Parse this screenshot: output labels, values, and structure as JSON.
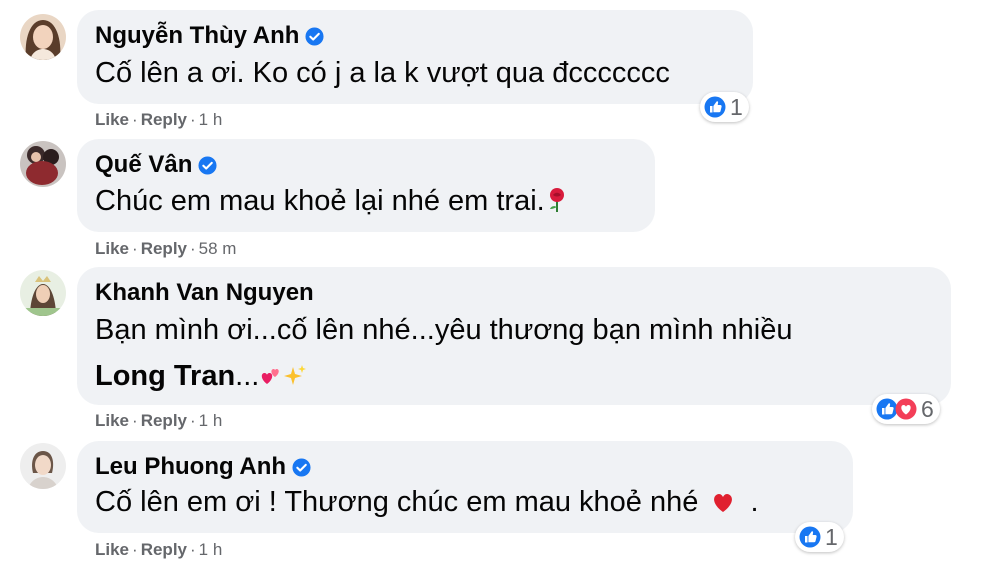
{
  "comments": [
    {
      "author": "Nguyễn Thùy Anh",
      "verified": true,
      "text_plain": "Cố lên a ơi. Ko có j a la k vượt qua đccccccc",
      "actions": {
        "like": "Like",
        "reply": "Reply",
        "time": "1 h"
      },
      "reaction_count": "1"
    },
    {
      "author": "Quế Vân",
      "verified": true,
      "text_plain": "Chúc em mau khoẻ lại nhé em trai.",
      "actions": {
        "like": "Like",
        "reply": "Reply",
        "time": "58 m"
      }
    },
    {
      "author": "Khanh Van Nguyen",
      "verified": false,
      "text_line1": "Bạn mình ơi...cố lên nhé...yêu thương bạn mình nhiều",
      "mention": "Long Tran",
      "text_after_mention": "...",
      "actions": {
        "like": "Like",
        "reply": "Reply",
        "time": "1 h"
      },
      "reaction_count": "6"
    },
    {
      "author": "Leu Phuong Anh",
      "verified": true,
      "text_plain": "Cố lên em ơi ! Thương chúc em mau khoẻ nhé",
      "text_tail": ".",
      "actions": {
        "like": "Like",
        "reply": "Reply",
        "time": "1 h"
      },
      "reaction_count": "1"
    }
  ],
  "colors": {
    "bubble": "#f0f2f5",
    "verified": "#1877f2",
    "like": "#1877f2",
    "love": "#f33e58",
    "meta": "#65676b"
  },
  "icons": {
    "verified": "verified-badge-icon",
    "like": "like-reaction-icon",
    "love": "love-reaction-icon",
    "rose": "rose-emoji-icon",
    "hearts": "two-hearts-emoji-icon",
    "sparkles": "sparkles-emoji-icon",
    "heart": "red-heart-emoji-icon"
  }
}
